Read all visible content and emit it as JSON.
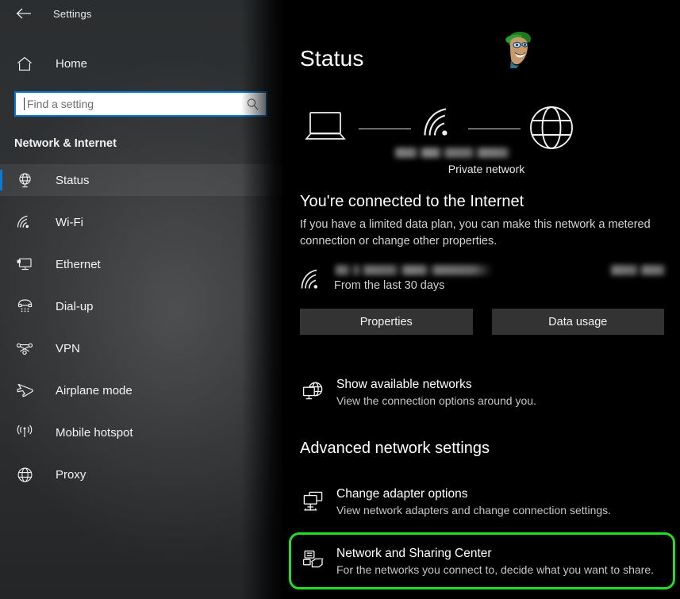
{
  "window": {
    "title": "Settings",
    "back_icon": "back-arrow-icon"
  },
  "sidebar": {
    "home_label": "Home",
    "home_icon": "home-icon",
    "search": {
      "placeholder": "Find a setting",
      "value": "",
      "icon": "search-icon"
    },
    "section_heading": "Network & Internet",
    "items": [
      {
        "label": "Status",
        "icon": "globe-status-icon",
        "active": true
      },
      {
        "label": "Wi-Fi",
        "icon": "wifi-icon",
        "active": false
      },
      {
        "label": "Ethernet",
        "icon": "ethernet-icon",
        "active": false
      },
      {
        "label": "Dial-up",
        "icon": "dialup-phone-icon",
        "active": false
      },
      {
        "label": "VPN",
        "icon": "vpn-icon",
        "active": false
      },
      {
        "label": "Airplane mode",
        "icon": "airplane-icon",
        "active": false
      },
      {
        "label": "Mobile hotspot",
        "icon": "hotspot-icon",
        "active": false
      },
      {
        "label": "Proxy",
        "icon": "proxy-globe-icon",
        "active": false
      }
    ]
  },
  "main": {
    "page_title": "Status",
    "avatar_icon": "user-avatar-watermark",
    "diagram": {
      "device_icon": "laptop-icon",
      "signal_icon": "wifi-signal-icon",
      "internet_icon": "globe-icon",
      "network_name_redacted": true,
      "network_type_label": "Private network"
    },
    "connection": {
      "heading": "You're connected to the Internet",
      "description": "If you have a limited data plan, you can make this network a metered connection or change other properties."
    },
    "data_usage": {
      "icon": "wifi-signal-icon",
      "network_name_redacted": true,
      "amount_redacted": true,
      "period_label": "From the last 30 days"
    },
    "buttons": {
      "properties": "Properties",
      "data_usage": "Data usage"
    },
    "show_networks": {
      "icon": "monitor-globe-icon",
      "title": "Show available networks",
      "subtitle": "View the connection options around you."
    },
    "advanced": {
      "heading": "Advanced network settings",
      "links": [
        {
          "icon": "adapter-monitors-icon",
          "title": "Change adapter options",
          "subtitle": "View network adapters and change connection settings.",
          "highlighted": false
        },
        {
          "icon": "network-sharing-icon",
          "title": "Network and Sharing Center",
          "subtitle": "For the networks you connect to, decide what you want to share.",
          "highlighted": true
        }
      ]
    }
  },
  "colors": {
    "accent_blue": "#0a7bd4",
    "highlight_green": "#26dd26",
    "button_bg": "#333333",
    "main_bg": "#000000"
  }
}
